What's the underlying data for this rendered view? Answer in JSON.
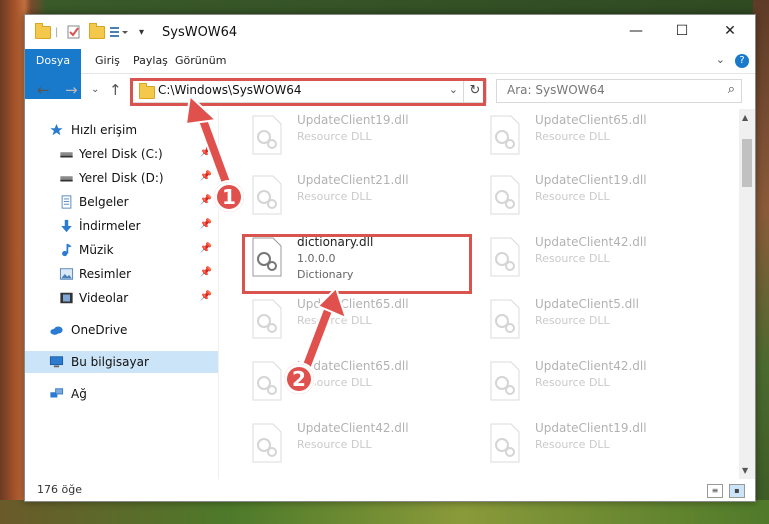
{
  "window": {
    "title": "SysWOW64",
    "minimize": "—",
    "maximize": "☐",
    "close": "✕"
  },
  "ribbon": {
    "tabs": [
      "Dosya",
      "Giriş",
      "Paylaş",
      "Görünüm"
    ],
    "help": "?"
  },
  "nav": {
    "address": "C:\\Windows\\SysWOW64",
    "search_placeholder": "Ara: SysWOW64"
  },
  "sidebar": {
    "items": [
      {
        "label": "Hızlı erişim",
        "icon": "star-icon"
      },
      {
        "label": "Yerel Disk (C:)",
        "icon": "drive-icon",
        "pinned": true
      },
      {
        "label": "Yerel Disk (D:)",
        "icon": "drive-icon",
        "pinned": true
      },
      {
        "label": "Belgeler",
        "icon": "documents-icon",
        "pinned": true
      },
      {
        "label": "İndirmeler",
        "icon": "download-icon",
        "pinned": true
      },
      {
        "label": "Müzik",
        "icon": "music-icon",
        "pinned": true
      },
      {
        "label": "Resimler",
        "icon": "pictures-icon",
        "pinned": true
      },
      {
        "label": "Videolar",
        "icon": "videos-icon",
        "pinned": true
      },
      {
        "label": "OneDrive",
        "icon": "cloud-icon"
      },
      {
        "label": "Bu bilgisayar",
        "icon": "computer-icon",
        "selected": true
      },
      {
        "label": "Ağ",
        "icon": "network-icon"
      }
    ]
  },
  "files": {
    "col1": [
      {
        "name": "UpdateClient19.dll",
        "type": "Resource DLL"
      },
      {
        "name": "UpdateClient21.dll",
        "type": "Resource DLL"
      },
      {
        "name": "dictionary.dll",
        "version": "1.0.0.0",
        "type": "Dictionary"
      },
      {
        "name": "UpdateClient65.dll",
        "type": "Resource DLL"
      },
      {
        "name": "UpdateClient65.dll",
        "type": "Resource DLL"
      },
      {
        "name": "UpdateClient42.dll",
        "type": "Resource DLL"
      }
    ],
    "col2": [
      {
        "name": "UpdateClient65.dll",
        "type": "Resource DLL"
      },
      {
        "name": "UpdateClient19.dll",
        "type": "Resource DLL"
      },
      {
        "name": "UpdateClient42.dll",
        "type": "Resource DLL"
      },
      {
        "name": "UpdateClient5.dll",
        "type": "Resource DLL"
      },
      {
        "name": "UpdateClient42.dll",
        "type": "Resource DLL"
      },
      {
        "name": "UpdateClient19.dll",
        "type": "Resource DLL"
      }
    ]
  },
  "status": {
    "count": "176 öğe"
  },
  "callouts": [
    "1",
    "2"
  ],
  "colors": {
    "accent": "#1979ca",
    "highlight": "#d9534f",
    "selected": "#cce4f7"
  }
}
